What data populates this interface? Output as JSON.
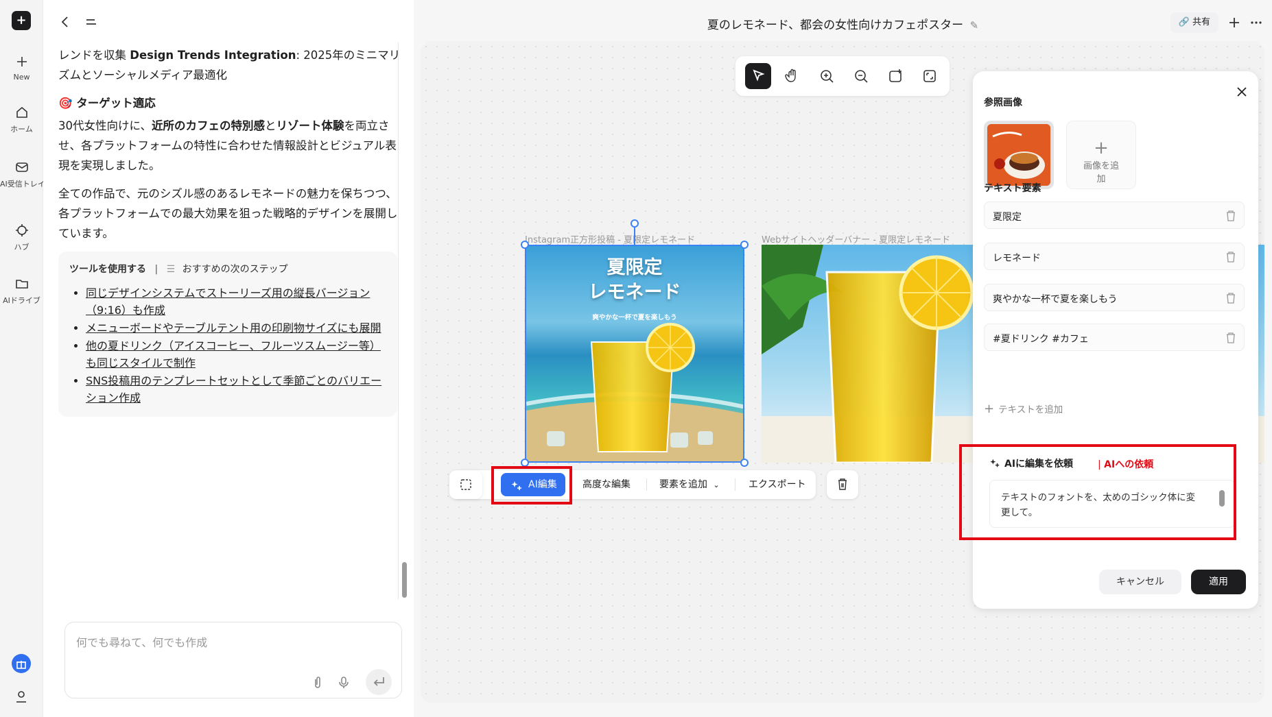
{
  "rail": {
    "items": [
      {
        "label": "New",
        "icon": "plus-icon"
      },
      {
        "label": "ホーム",
        "icon": "home-icon"
      },
      {
        "label": "AI受信トレイ",
        "icon": "inbox-icon"
      },
      {
        "label": "ハブ",
        "icon": "hub-icon"
      },
      {
        "label": "AIドライブ",
        "icon": "folder-icon"
      }
    ]
  },
  "chat": {
    "para1_pre": "レンドを収集 ",
    "para1_bold": "Design Trends Integration",
    "para1_post": ": 2025年のミニマリズムとソーシャルメディア最適化",
    "target_heading": "🎯 ターゲット適応",
    "para2_a": "30代女性向けに、",
    "para2_b": "近所のカフェの特別感",
    "para2_c": "と",
    "para2_d": "リゾート体験",
    "para2_e": "を両立させ、各プラットフォームの特性に合わせた情報設計とビジュアル表現を実現しました。",
    "para3": "全ての作品で、元のシズル感のあるレモネードの魅力を保ちつつ、各プラットフォームでの最大効果を狙った戦略的デザインを展開しています。",
    "tools_label": "ツールを使用する",
    "next_steps_label": "おすすめの次のステップ",
    "next_steps": [
      "同じデザインシステムでストーリーズ用の縦長バージョン（9:16）も作成",
      "メニューボードやテーブルテント用の印刷物サイズにも展開",
      "他の夏ドリンク（アイスコーヒー、フルーツスムージー等）も同じスタイルで制作",
      "SNS投稿用のテンプレートセットとして季節ごとのバリエーション作成"
    ],
    "composer_placeholder": "何でも尋ねて、何でも作成"
  },
  "header": {
    "title": "夏のレモネード、都会の女性向けカフェポスター",
    "share_label": "共有"
  },
  "artboards": {
    "art1_label": "Instagram正方形投稿 - 夏限定レモネード",
    "art1_title": "夏限定\nレモネード",
    "art1_sub": "爽やかな一杯で夏を楽しもう",
    "art1_hashtag": "#夏ドリンク #カフェ",
    "art2_label": "Webサイトヘッダーバナー - 夏限定レモネード"
  },
  "action_bar": {
    "ai_edit": "AI編集",
    "advanced_edit": "高度な編集",
    "add_element": "要素を追加",
    "export": "エクスポート"
  },
  "panel": {
    "ref_heading": "参照画像",
    "add_image": "画像を追加",
    "text_heading": "テキスト要素",
    "text_items": [
      "夏限定",
      "レモネード",
      "爽やかな一杯で夏を楽しもう",
      "#夏ドリンク #カフェ"
    ],
    "add_text": "テキストを追加",
    "ai_request_heading": "AIに編集を依頼",
    "ai_request_tag": "AIへの依頼",
    "ai_request_text": "テキストのフォントを、太めのゴシック体に変更して。",
    "cancel": "キャンセル",
    "apply": "適用"
  },
  "colors": {
    "accent": "#2f6ff0",
    "highlight": "#e30914",
    "dark": "#1d1d1f"
  }
}
